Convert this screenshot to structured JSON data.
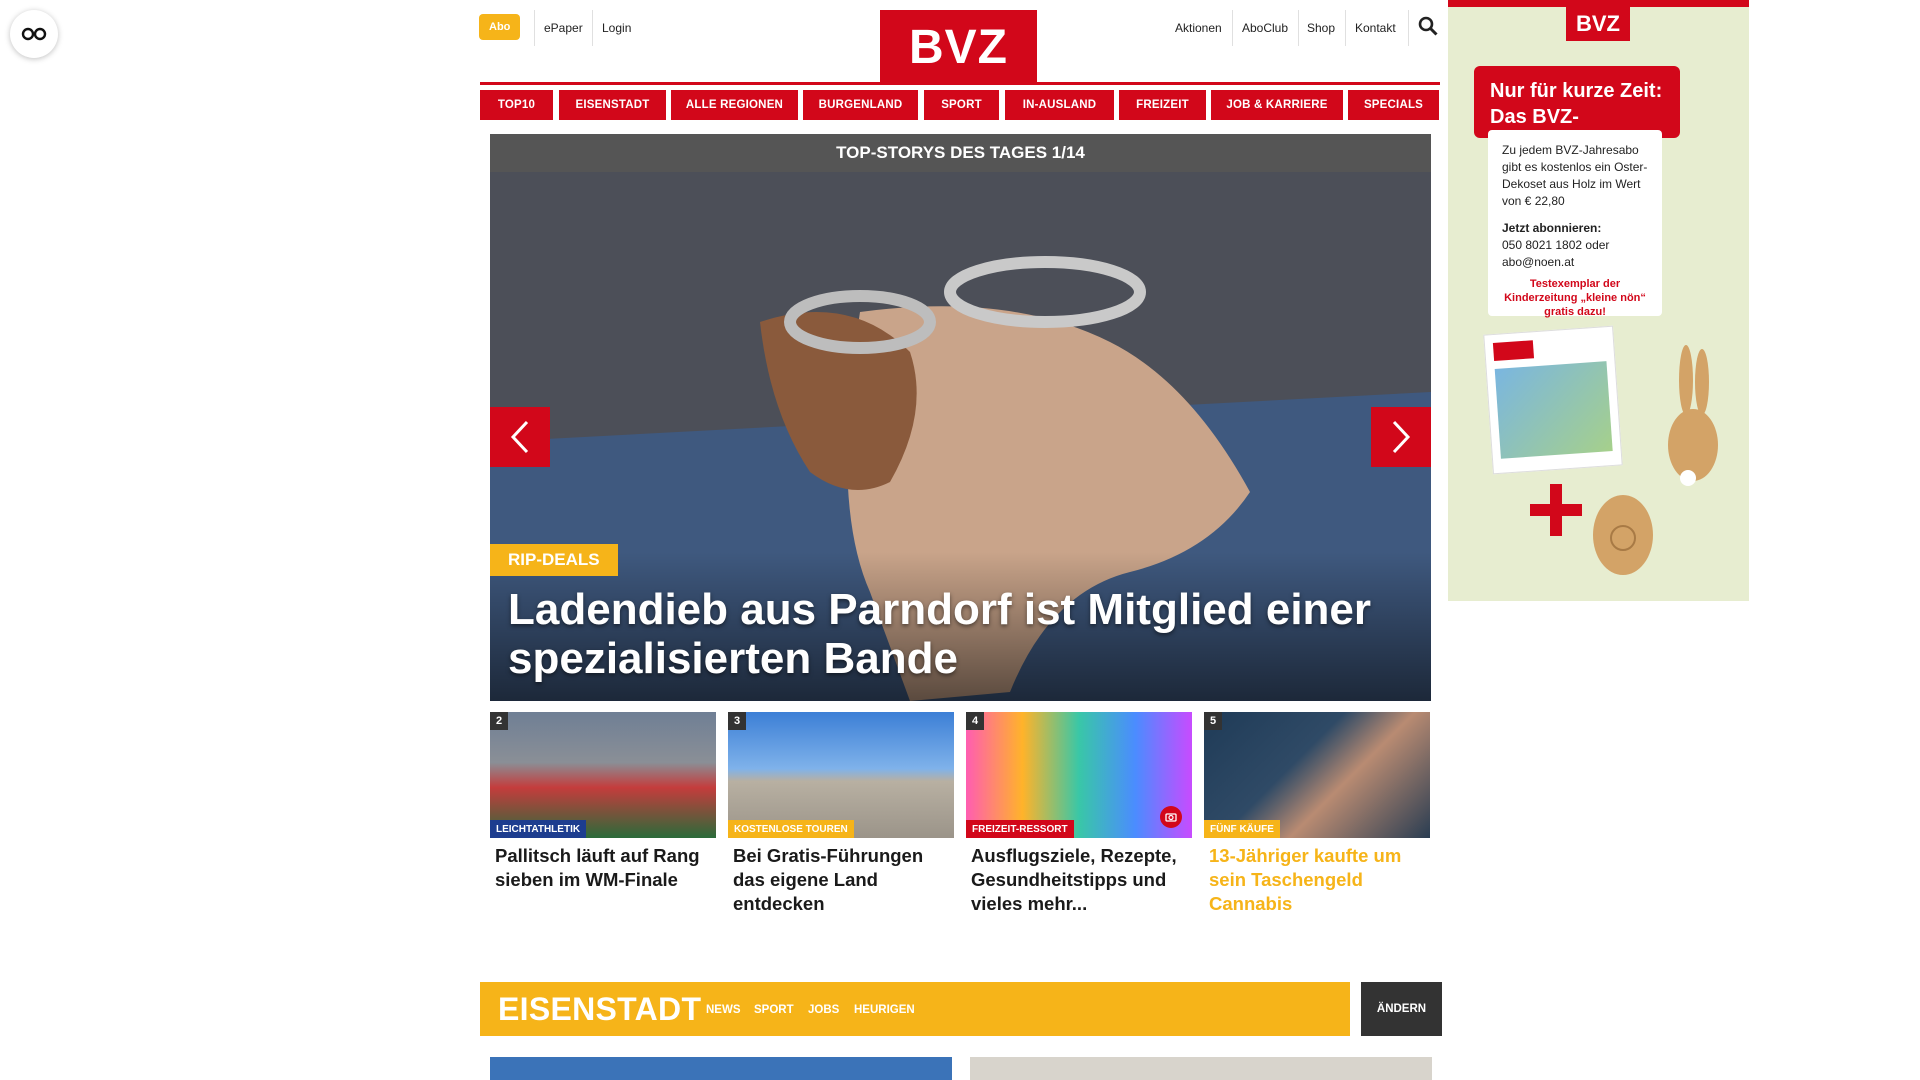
{
  "header": {
    "abo": "Abo",
    "epaper": "ePaper",
    "login": "Login",
    "logo": "BVZ",
    "right_links": [
      "Aktionen",
      "AboClub",
      "Shop",
      "Kontakt"
    ]
  },
  "nav": [
    "TOP10",
    "EISENSTADT",
    "ALLE REGIONEN",
    "BURGENLAND",
    "SPORT",
    "IN-AUSLAND",
    "FREIZEIT",
    "JOB & KARRIERE",
    "SPECIALS"
  ],
  "slider": {
    "header": "TOP-STORYS DES TAGES 1/14",
    "badge": "RIP-DEALS",
    "headline": "Ladendieb aus Parndorf ist Mitglied einer spezialisierten Bande"
  },
  "cards": [
    {
      "num": "2",
      "tag": "LEICHTATHLETIK",
      "tag_color": "#1d3d8f",
      "title": "Pallitsch läuft auf Rang sieben im WM-Finale",
      "title_color": "#1a1a1a"
    },
    {
      "num": "3",
      "tag": "KOSTENLOSE TOUREN",
      "tag_color": "#f6b419",
      "title": "Bei Gratis-Führungen das eigene Land entdecken",
      "title_color": "#1a1a1a"
    },
    {
      "num": "4",
      "tag": "FREIZEIT-RESSORT",
      "tag_color": "#d2071a",
      "title": "Ausflugsziele, Rezepte, Gesundheitstipps und vieles mehr...",
      "title_color": "#1a1a1a"
    },
    {
      "num": "5",
      "tag": "FÜNF KÄUFE",
      "tag_color": "#f6b419",
      "title": "13-Jähriger kaufte um sein Taschengeld Cannabis",
      "title_color": "#f6b419"
    }
  ],
  "section": {
    "title": "EISENSTADT",
    "links": [
      "NEWS",
      "SPORT",
      "JOBS",
      "HEURIGEN"
    ],
    "change": "ÄNDERN"
  },
  "ad": {
    "logo": "BVZ",
    "headline_1": "Nur für kurze Zeit:",
    "headline_2": "Das BVZ-Osterabo!",
    "body_1": "Zu jedem BVZ-Jahresabo gibt es kostenlos ein Oster-Dekoset aus Holz im Wert von € 22,80",
    "cta_title": "Jetzt abonnieren:",
    "cta_body": "050 8021 1802 oder abo@noen.at",
    "extra": "Testexemplar der Kinderzeitung „kleine nön“ gratis dazu!"
  },
  "colors": {
    "brand_red": "#d2071a",
    "accent_yellow": "#f6b419"
  }
}
